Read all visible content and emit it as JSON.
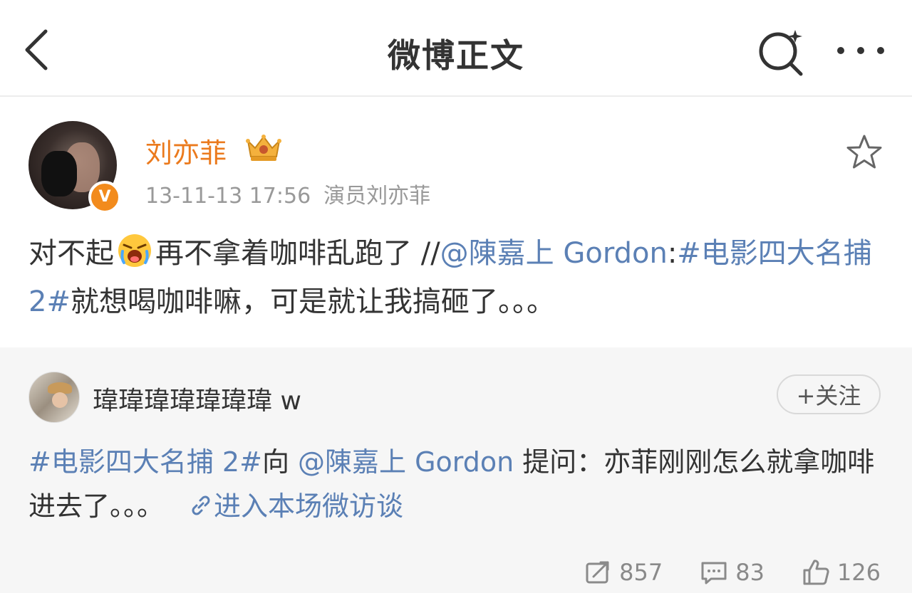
{
  "nav": {
    "title": "微博正文"
  },
  "post": {
    "username": "刘亦菲",
    "verified_badge": "V",
    "time": "13-11-13 17:56",
    "source": "演员刘亦菲",
    "text_before_emoji": "对不起",
    "emoji": "crying-face-emoji",
    "text_after_emoji": "再不拿着咖啡乱跑了 //",
    "mention": "@陳嘉上 Gordon",
    "colon": ":",
    "hashtag": "#电影四大名捕 2#",
    "text_tail": "就想喝咖啡嘛，可是就让我搞砸了。。。"
  },
  "repost": {
    "username": "瑋瑋瑋瑋瑋瑋瑋 w",
    "follow_label": "+关注",
    "hashtag": "#电影四大名捕 2#",
    "text_1": "向 ",
    "mention": "@陳嘉上 Gordon",
    "text_2": " 提问：亦菲刚刚怎么就拿咖啡进去了。。。",
    "link_label": "进入本场微访谈",
    "stats": {
      "reposts": "857",
      "comments": "83",
      "likes": "126"
    }
  },
  "colors": {
    "accent_orange": "#eb7a1d",
    "link_blue": "#5b80b5",
    "repost_bg": "#f6f6f6"
  }
}
